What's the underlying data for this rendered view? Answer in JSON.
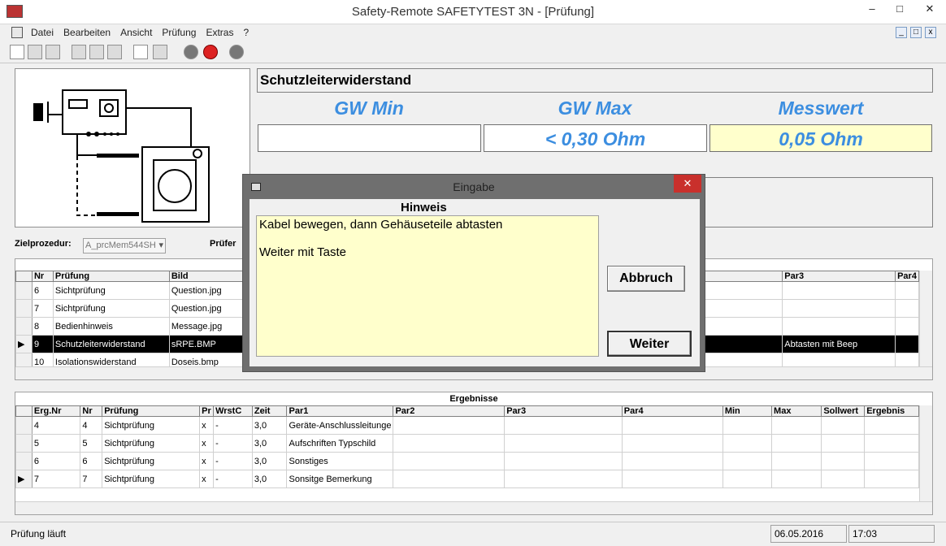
{
  "window": {
    "title": "Safety-Remote SAFETYTEST 3N - [Prüfung]"
  },
  "menu": [
    "Datei",
    "Bearbeiten",
    "Ansicht",
    "Prüfung",
    "Extras",
    "?"
  ],
  "test": {
    "name": "Schutzleiterwiderstand",
    "gw_min_label": "GW Min",
    "gw_max_label": "GW Max",
    "messwert_label": "Messwert",
    "gw_min_value": "",
    "gw_max_value": "< 0,30 Ohm",
    "messwert_value": "0,05 Ohm"
  },
  "form": {
    "zielprozedur_label": "Zielprozedur:",
    "zielprozedur_value": "A_prcMem544SH",
    "pruefer_label": "Prüfer"
  },
  "steps_table": {
    "headers": [
      "Nr",
      "Prüfung",
      "Bild",
      "Par3",
      "Par4"
    ],
    "rows": [
      {
        "nr": "6",
        "pruefung": "Sichtprüfung",
        "bild": "Question.jpg",
        "par3": ""
      },
      {
        "nr": "7",
        "pruefung": "Sichtprüfung",
        "bild": "Question.jpg",
        "par3": ""
      },
      {
        "nr": "8",
        "pruefung": "Bedienhinweis",
        "bild": "Message.jpg",
        "par3": ""
      },
      {
        "nr": "9",
        "pruefung": "Schutzleiterwiderstand",
        "bild": "sRPE.BMP",
        "par3": "Abtasten mit Beep"
      },
      {
        "nr": "10",
        "pruefung": "Isolationswiderstand",
        "bild": "Doseis.bmp",
        "par3": ""
      }
    ]
  },
  "results": {
    "title": "Ergebnisse",
    "headers": [
      "Erg.Nr",
      "Nr",
      "Prüfung",
      "Pr",
      "WrstC",
      "Zeit",
      "Par1",
      "Par2",
      "Par3",
      "Par4",
      "Min",
      "Max",
      "Sollwert",
      "Ergebnis"
    ],
    "rows": [
      {
        "ergnr": "4",
        "nr": "4",
        "pruefung": "Sichtprüfung",
        "pr": "x",
        "wrst": "-",
        "zeit": "3,0",
        "par1": "Geräte-Anschlussleitunge"
      },
      {
        "ergnr": "5",
        "nr": "5",
        "pruefung": "Sichtprüfung",
        "pr": "x",
        "wrst": "-",
        "zeit": "3,0",
        "par1": "Aufschriften Typschild"
      },
      {
        "ergnr": "6",
        "nr": "6",
        "pruefung": "Sichtprüfung",
        "pr": "x",
        "wrst": "-",
        "zeit": "3,0",
        "par1": "Sonstiges"
      },
      {
        "ergnr": "7",
        "nr": "7",
        "pruefung": "Sichtprüfung",
        "pr": "x",
        "wrst": "-",
        "zeit": "3,0",
        "par1": "Sonsitge Bemerkung"
      }
    ]
  },
  "dialog": {
    "title": "Eingabe",
    "heading": "Hinweis",
    "line1": "Kabel bewegen, dann Gehäuseteile abtasten",
    "line2": "Weiter mit Taste",
    "cancel_label": "Abbruch",
    "continue_label": "Weiter",
    "close_label": "✕"
  },
  "status": {
    "text": "Prüfung läuft",
    "date": "06.05.2016",
    "time": "17:03"
  },
  "colors": {
    "accent_blue": "#3c8ee0",
    "highlight_yellow": "#ffffcc",
    "close_red": "#c9302c"
  }
}
